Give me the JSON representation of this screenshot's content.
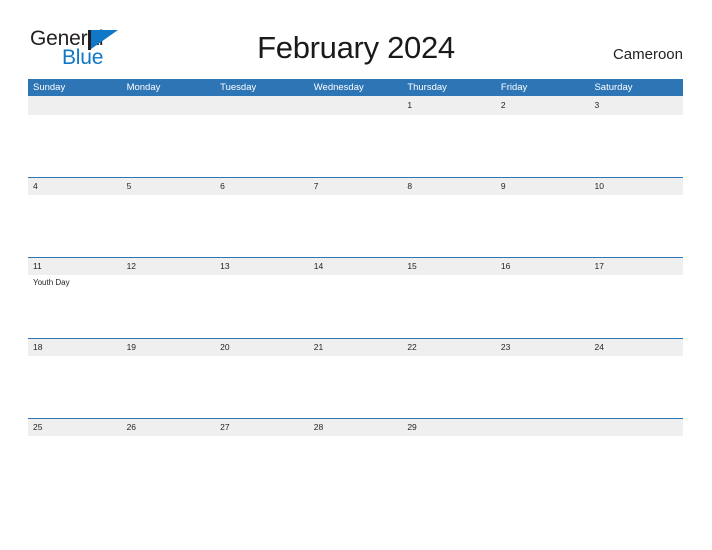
{
  "brand": {
    "name_part1": "General",
    "name_part2": "Blue",
    "flag_icon": "blue-flag-icon",
    "accent_color": "#1177c7"
  },
  "header": {
    "title": "February 2024",
    "region": "Cameroon"
  },
  "theme": {
    "header_blue": "#2e75b6",
    "band_gray": "#efefef",
    "text_dark": "#231f20",
    "page_background": "#ffffff"
  },
  "calendar": {
    "month": "February",
    "year": "2024",
    "weekday_headers": [
      "Sunday",
      "Monday",
      "Tuesday",
      "Wednesday",
      "Thursday",
      "Friday",
      "Saturday"
    ],
    "weeks": [
      {
        "days": [
          {
            "date": "",
            "event": ""
          },
          {
            "date": "",
            "event": ""
          },
          {
            "date": "",
            "event": ""
          },
          {
            "date": "",
            "event": ""
          },
          {
            "date": "1",
            "event": ""
          },
          {
            "date": "2",
            "event": ""
          },
          {
            "date": "3",
            "event": ""
          }
        ]
      },
      {
        "days": [
          {
            "date": "4",
            "event": ""
          },
          {
            "date": "5",
            "event": ""
          },
          {
            "date": "6",
            "event": ""
          },
          {
            "date": "7",
            "event": ""
          },
          {
            "date": "8",
            "event": ""
          },
          {
            "date": "9",
            "event": ""
          },
          {
            "date": "10",
            "event": ""
          }
        ]
      },
      {
        "days": [
          {
            "date": "11",
            "event": "Youth Day"
          },
          {
            "date": "12",
            "event": ""
          },
          {
            "date": "13",
            "event": ""
          },
          {
            "date": "14",
            "event": ""
          },
          {
            "date": "15",
            "event": ""
          },
          {
            "date": "16",
            "event": ""
          },
          {
            "date": "17",
            "event": ""
          }
        ]
      },
      {
        "days": [
          {
            "date": "18",
            "event": ""
          },
          {
            "date": "19",
            "event": ""
          },
          {
            "date": "20",
            "event": ""
          },
          {
            "date": "21",
            "event": ""
          },
          {
            "date": "22",
            "event": ""
          },
          {
            "date": "23",
            "event": ""
          },
          {
            "date": "24",
            "event": ""
          }
        ]
      },
      {
        "days": [
          {
            "date": "25",
            "event": ""
          },
          {
            "date": "26",
            "event": ""
          },
          {
            "date": "27",
            "event": ""
          },
          {
            "date": "28",
            "event": ""
          },
          {
            "date": "29",
            "event": ""
          },
          {
            "date": "",
            "event": ""
          },
          {
            "date": "",
            "event": ""
          }
        ]
      }
    ]
  }
}
